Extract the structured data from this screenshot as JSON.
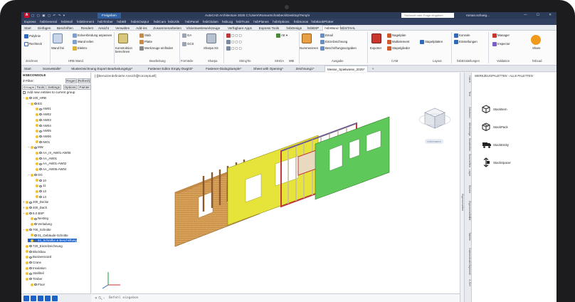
{
  "titlebar": {
    "logo": "A",
    "share": "Freigeben",
    "title": "AutoCAD Architecture 2025   C:\\Users\\RomanSchüsbeck\\Desktop\\Temp\\I",
    "search_placeholder": "Stichwort oder Frage eingeben",
    "user": "roman.schueg...",
    "window_controls": "— ☐ ✕"
  },
  "menubar": [
    "Express",
    "hsbGeneral",
    "hsbWall",
    "hsbElement",
    "hsbTimber",
    "hsbBlt",
    "hsbInOutput",
    "hsbCam",
    "hsbUtils",
    "hsbPanel",
    "hsbGlulam",
    "hsbLog",
    "hsbTruss",
    "hsbPlanes",
    "hsbOptions",
    "hsbSonos",
    "hsbBookPlotter"
  ],
  "ribbon_tabs": {
    "items": [
      "Start",
      "Einfügen",
      "Beschriften",
      "Rendern",
      "Ansicht",
      "Verwalten",
      "Add-ins",
      "Zusammenarbeiten",
      "Visionsweitewerkzeuge",
      "Verfügbare Apps",
      "Express Tools",
      "hsbDesign",
      "hsbBSP",
      "hsbWand",
      "hsbSTAHL"
    ],
    "active_index": 13
  },
  "ribbon": {
    "polyline": "Polylinie",
    "rechteck": "Rechteck",
    "zeichnen": "Zeichnen",
    "wand_frei": "Wand frei",
    "hrb_wand": "HRB Wand",
    "e1": "Eckverbindung anpassen",
    "e2": "Wand teilen",
    "e3": "Elektro",
    "konst": "Konstruktion berechnen",
    "stab": "Stab",
    "platte": "Platte",
    "werkzeuge": "Werkzeuge einfinden",
    "bearbeitung": "Bearbeitung",
    "ga": "GA",
    "gcs": "GCS",
    "formteile": "Formteile",
    "sharpa": "Sharpa XS",
    "sharpa_g": "Sharpa",
    "stringtie": "StringTie",
    "sihga": "SIHGA",
    "mbi": "MBI",
    "nummerieren": "Nummerieren",
    "email": "Email",
    "einzel": "Einzelzeichnung",
    "beschr": "Beschriftungsvorgaben",
    "ausgabe": "Ausgabe",
    "exporter": "Exporter",
    "nagel": "Nagelplan",
    "multi": "Multielement",
    "stapel": "Stapelglieder",
    "cam": "CAM",
    "konsole": "Konsole",
    "einstell": "Einstellungen",
    "stapelplatten": "Stapelplatten",
    "layout": "Layout",
    "hsbeinst": "hsbEinstellungen",
    "manager": "Manager",
    "inspector": "Inspector",
    "validation": "Validation",
    "share": "Share",
    "hsbcad": "hsbcad"
  },
  "doctabs": [
    "Start",
    "SceneWalls*",
    "Musterzeichnung Export Bearbeitungstyp*",
    "Fastener Editor Empty Dwg03*",
    "Fastener-DialogSample*",
    "Sheet with Opening*",
    "Zeichnung1*",
    "Messe_Spielwiese_2025*",
    "+"
  ],
  "doctabs_active": 7,
  "leftpanel": {
    "title": "HSBCONSOLE",
    "filter": "Z-Filter:",
    "regen": "Regen",
    "refresh": "Refresh",
    "tabs": [
      "Groups",
      "Tools",
      "Settings",
      "Options",
      "Painter"
    ],
    "add_label": "Add new entities to current group",
    "tree": [
      {
        "d": 0,
        "t": "−",
        "label": "100_HRB"
      },
      {
        "d": 1,
        "t": "−",
        "label": "EG"
      },
      {
        "d": 2,
        "t": "",
        "label": "AW01"
      },
      {
        "d": 2,
        "t": "",
        "label": "AW02"
      },
      {
        "d": 2,
        "t": "",
        "label": "AW03"
      },
      {
        "d": 2,
        "t": "",
        "label": "AW04"
      },
      {
        "d": 2,
        "t": "",
        "label": "AW05"
      },
      {
        "d": 2,
        "t": "",
        "label": "AW06"
      },
      {
        "d": 2,
        "t": "",
        "label": "IW01"
      },
      {
        "d": 1,
        "t": "−",
        "label": "MW"
      },
      {
        "d": 2,
        "t": "",
        "label": "AA_III_AW01-AW05"
      },
      {
        "d": 2,
        "t": "",
        "label": "AA_AW01"
      },
      {
        "d": 2,
        "t": "",
        "label": "AA_AW01-AW02"
      },
      {
        "d": 2,
        "t": "",
        "label": "AA_AW06-AW04"
      },
      {
        "d": 1,
        "t": "−",
        "label": "OG"
      },
      {
        "d": 2,
        "t": "",
        "label": "10"
      },
      {
        "d": 2,
        "t": "",
        "label": "11"
      },
      {
        "d": 2,
        "t": "",
        "label": "13"
      },
      {
        "d": 2,
        "t": "",
        "label": "14"
      },
      {
        "d": 0,
        "t": "+",
        "label": "200_Decke"
      },
      {
        "d": 0,
        "t": "+",
        "label": "400_Dach"
      },
      {
        "d": 0,
        "t": "−",
        "label": "6.0 BSP"
      },
      {
        "d": 1,
        "t": "",
        "label": "Nesting"
      },
      {
        "d": 1,
        "t": "",
        "label": "Verladung"
      },
      {
        "d": 0,
        "t": "−",
        "label": "700_Schnitte"
      },
      {
        "d": 1,
        "t": "",
        "label": "01_Gebäude-Schnitte"
      },
      {
        "d": 1,
        "t": "",
        "label": "04_Schraffur & Beschriftung",
        "sel": true
      },
      {
        "d": 0,
        "t": "",
        "label": "720_Einzelzeichnung"
      },
      {
        "d": 0,
        "t": "",
        "label": "Blockbau"
      },
      {
        "d": 0,
        "t": "",
        "label": "Businesscard"
      },
      {
        "d": 0,
        "t": "",
        "label": "Crane"
      },
      {
        "d": 0,
        "t": "",
        "label": "Insulation"
      },
      {
        "d": 0,
        "t": "",
        "label": "Stahlteil"
      },
      {
        "d": 0,
        "t": "",
        "label": "Timber"
      },
      {
        "d": 1,
        "t": "",
        "label": "Floor"
      }
    ]
  },
  "viewport": {
    "label": "[-][Benutzerdefinierte Ansicht][Konzeptuell]",
    "viewcube_label": "Unbenannt"
  },
  "cmdline": {
    "placeholder": "Befehl eingeben"
  },
  "rightstrip": [
    "Hatch",
    "Text",
    "Zeichnen",
    "Werkzeuge",
    "Bearbeiten",
    "Beschriften",
    "Layer",
    "Blöcke",
    "Eigenschaften",
    "Stil",
    "Tabelle",
    "Datenextrakt",
    "Objektstil",
    "X-Ref"
  ],
  "palette": {
    "title": "WERKZEUGPALETTEN - ALLE PALETTEN",
    "items": [
      "StackItem",
      "StackPack",
      "StackEntity",
      "StackSpacer"
    ],
    "side_label": "Eigenschaften"
  },
  "colors": {
    "frame": "#1c1c1e",
    "titlebar": "#2b3a57",
    "accent": "#1e62c8",
    "wall_osb": "#d8a25a",
    "wall_yellow": "#e6e43a",
    "wall_green": "#5fc85a",
    "wall_frame": "#c23a3a"
  }
}
